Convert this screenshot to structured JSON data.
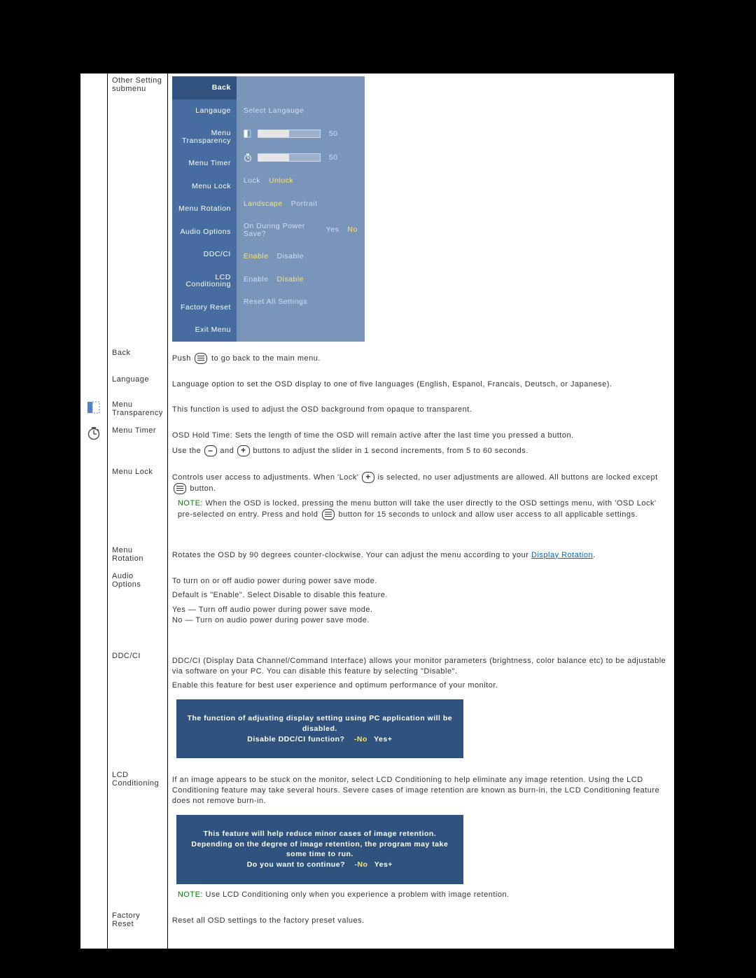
{
  "row_other_setting": {
    "label": "Other Setting submenu"
  },
  "osd": {
    "labels": [
      "Back",
      "Langauge",
      "Menu Transparency",
      "Menu Timer",
      "Menu Lock",
      "Menu Rotation",
      "Audio Options",
      "DDC/CI",
      "LCD Conditioning",
      "Factory Reset",
      "Exit Menu"
    ],
    "v_language": "Select Langauge",
    "v_transparency_val": "50",
    "v_timer_val": "50",
    "v_lock_lock": "Lock",
    "v_lock_unlock": "Unlock",
    "v_rotation_landscape": "Landscape",
    "v_rotation_portrait": "Portrait",
    "v_audio_q": "On During Power Save?",
    "v_audio_yes": "Yes",
    "v_audio_no": "No",
    "v_ddc_enable": "Enable",
    "v_ddc_disable": "Disable",
    "v_lcd_enable": "Enable",
    "v_lcd_disable": "Disable",
    "v_factory": "Reset All Settings"
  },
  "row_back": {
    "label": "Back",
    "text_a": "Push ",
    "text_b": " to go back to the main menu."
  },
  "row_language": {
    "label": "Language",
    "text": "Language option to set the OSD display to one of five languages (English, Espanol, Francais, Deutsch, or Japanese)."
  },
  "row_transparency": {
    "label": "Menu Transparency",
    "text": "This function is used to adjust the OSD background from opaque to transparent."
  },
  "row_timer": {
    "label": "Menu Timer",
    "l1": "OSD Hold Time: Sets the length of time the OSD will remain active after the last time you pressed a button.",
    "l2_a": "Use the ",
    "l2_b": " and ",
    "l2_c": " buttons to adjust the slider in 1 second increments, from 5 to 60 seconds."
  },
  "row_lock": {
    "label": "Menu Lock",
    "l1_a": "Controls user access to adjustments. When 'Lock' ",
    "l1_b": " is selected, no user adjustments are allowed. All buttons are locked except ",
    "l1_c": " button.",
    "note_prefix": "NOTE:",
    "note_a": " When the OSD is locked, pressing the menu button will take the user directly to the OSD settings menu, with 'OSD Lock' pre-selected on entry. Press and hold ",
    "note_b": " button for 15 seconds to unlock and allow user access to all applicable settings."
  },
  "row_rotation": {
    "label": "Menu Rotation",
    "text_a": "Rotates the OSD by 90 degrees counter-clockwise. Your can adjust the menu according to your ",
    "link": "Display Rotation",
    "text_b": "."
  },
  "row_audio": {
    "label": "Audio Options",
    "l1": "To turn on or off audio power during power save mode.",
    "l2": "Default is \"Enable\". Select Disable to disable this feature.",
    "l3": "Yes — Turn off audio power during power save mode.",
    "l4": "No — Turn on audio power during power save mode."
  },
  "row_ddc": {
    "label": "DDC/CI",
    "l1": "DDC/CI (Display Data Channel/Command Interface) allows your monitor parameters (brightness, color balance etc) to be adjustable via software on your PC. You can disable this feature by selecting \"Disable\".",
    "l2": "Enable this feature for best user experience and optimum performance of your monitor.",
    "prompt_l1": "The function of adjusting display setting using PC application will be disabled.",
    "prompt_l2": "Disable DDC/CI function?    ",
    "prompt_no": "-No",
    "prompt_yes": "Yes+"
  },
  "row_lcd": {
    "label": "LCD Conditioning",
    "l1": "If an image appears to be stuck on the monitor, select LCD Conditioning to help eliminate any image retention. Using the LCD Conditioning feature may take several hours. Severe cases of image retention are known as burn-in, the LCD Conditioning feature does not remove burn-in.",
    "prompt_l1": "This feature will help reduce minor cases of image retention.",
    "prompt_l2": "Depending on the degree of image retention, the program may take some time to run.",
    "prompt_l3": "Do you want to continue?    ",
    "prompt_no": "-No",
    "prompt_yes": "Yes+",
    "note_prefix": "NOTE:",
    "note": " Use LCD Conditioning only when you experience a problem with image retention."
  },
  "row_factory": {
    "label": "Factory Reset",
    "text": "Reset all OSD settings to the factory preset values."
  }
}
